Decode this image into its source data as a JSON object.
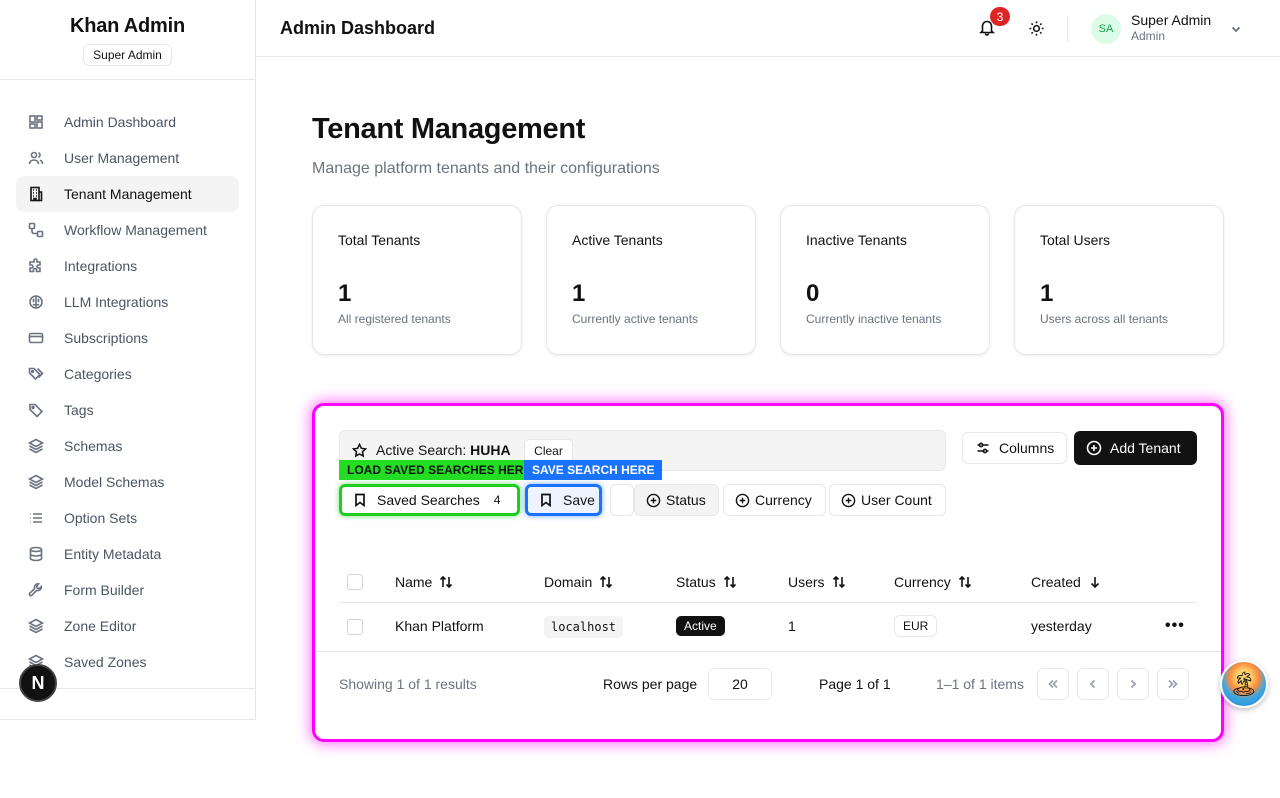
{
  "sidebar": {
    "brand_title": "Khan Admin",
    "brand_badge": "Super Admin",
    "items": [
      {
        "label": "Admin Dashboard",
        "icon": "dashboard-icon"
      },
      {
        "label": "User Management",
        "icon": "users-icon"
      },
      {
        "label": "Tenant Management",
        "icon": "building-icon",
        "active": true
      },
      {
        "label": "Workflow Management",
        "icon": "workflow-icon"
      },
      {
        "label": "Integrations",
        "icon": "puzzle-icon"
      },
      {
        "label": "LLM Integrations",
        "icon": "brain-icon"
      },
      {
        "label": "Subscriptions",
        "icon": "credit-card-icon"
      },
      {
        "label": "Categories",
        "icon": "tags-icon"
      },
      {
        "label": "Tags",
        "icon": "tag-icon"
      },
      {
        "label": "Schemas",
        "icon": "layers-icon"
      },
      {
        "label": "Model Schemas",
        "icon": "layers-icon"
      },
      {
        "label": "Option Sets",
        "icon": "list-icon"
      },
      {
        "label": "Entity Metadata",
        "icon": "database-icon"
      },
      {
        "label": "Form Builder",
        "icon": "wrench-icon"
      },
      {
        "label": "Zone Editor",
        "icon": "layers-icon"
      },
      {
        "label": "Saved Zones",
        "icon": "layers-icon"
      }
    ],
    "floating_badge": "N"
  },
  "header": {
    "title": "Admin Dashboard",
    "notification_count": "3",
    "avatar_initials": "SA",
    "user_name": "Super Admin",
    "user_role": "Admin"
  },
  "page": {
    "title": "Tenant Management",
    "subtitle": "Manage platform tenants and their configurations"
  },
  "stats": [
    {
      "label": "Total Tenants",
      "value": "1",
      "desc": "All registered tenants"
    },
    {
      "label": "Active Tenants",
      "value": "1",
      "desc": "Currently active tenants"
    },
    {
      "label": "Inactive Tenants",
      "value": "0",
      "desc": "Currently inactive tenants"
    },
    {
      "label": "Total Users",
      "value": "1",
      "desc": "Users across all tenants"
    }
  ],
  "toolbar": {
    "active_search_prefix": "Active Search: ",
    "active_search_name": "HUHA",
    "clear_label": "Clear",
    "columns_label": "Columns",
    "add_label": "Add Tenant",
    "tag_load": "LOAD SAVED SEARCHES HERE",
    "tag_save": "SAVE SEARCH HERE",
    "saved_searches_label": "Saved Searches",
    "saved_searches_count": "4",
    "save_label": "Save",
    "filters": [
      "Status",
      "Currency",
      "User Count"
    ]
  },
  "table": {
    "columns": [
      "Name",
      "Domain",
      "Status",
      "Users",
      "Currency",
      "Created"
    ],
    "rows": [
      {
        "name": "Khan Platform",
        "domain": "localhost",
        "status": "Active",
        "users": "1",
        "currency": "EUR",
        "created": "yesterday",
        "actions": "•••"
      }
    ]
  },
  "pagination": {
    "showing": "Showing 1 of 1 results",
    "rows_per_page_label": "Rows per page",
    "rows_per_page": "20",
    "page_of": "Page 1 of 1",
    "items_of": "1–1 of 1 items"
  },
  "colors": {
    "highlight_panel": "#ff00ff",
    "load_tag": "#22dd22",
    "save_tag": "#1a73ff",
    "primary": "#111111",
    "notification": "#dc2626"
  }
}
